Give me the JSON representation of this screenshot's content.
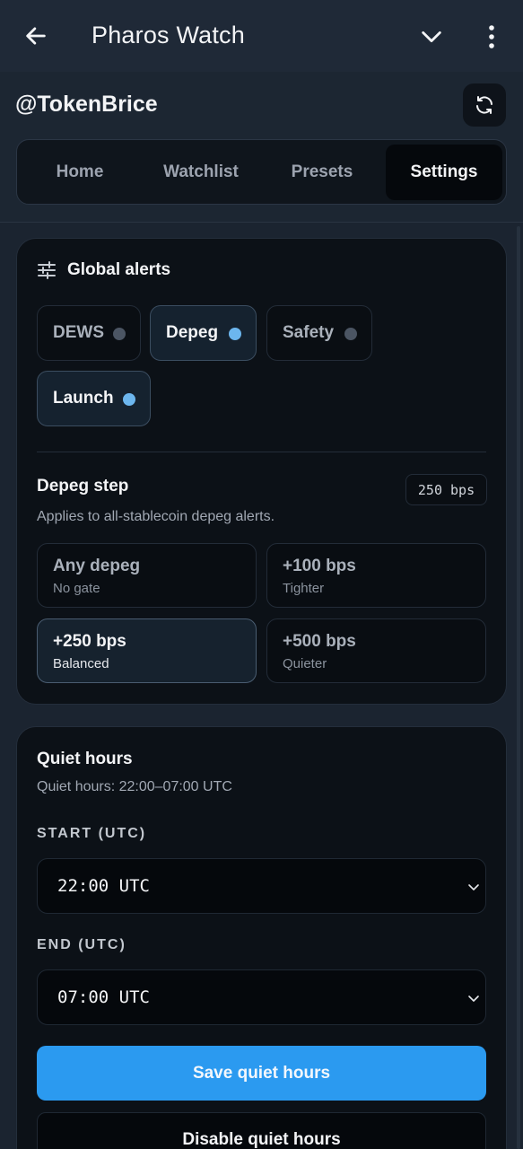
{
  "app": {
    "title": "Pharos Watch"
  },
  "header": {
    "handle": "@TokenBrice"
  },
  "tabs": [
    {
      "label": "Home"
    },
    {
      "label": "Watchlist"
    },
    {
      "label": "Presets"
    },
    {
      "label": "Settings",
      "active": true
    }
  ],
  "global_alerts": {
    "title": "Global alerts",
    "chips": [
      {
        "label": "DEWS",
        "enabled": false
      },
      {
        "label": "Depeg",
        "enabled": true
      },
      {
        "label": "Safety",
        "enabled": false
      },
      {
        "label": "Launch",
        "enabled": true
      }
    ],
    "depeg_step": {
      "title": "Depeg step",
      "value_badge": "250 bps",
      "description": "Applies to all-stablecoin depeg alerts.",
      "options": [
        {
          "title": "Any depeg",
          "sub": "No gate",
          "selected": false
        },
        {
          "title": "+100 bps",
          "sub": "Tighter",
          "selected": false
        },
        {
          "title": "+250 bps",
          "sub": "Balanced",
          "selected": true
        },
        {
          "title": "+500 bps",
          "sub": "Quieter",
          "selected": false
        }
      ]
    }
  },
  "quiet_hours": {
    "title": "Quiet hours",
    "summary": "Quiet hours: 22:00–07:00 UTC",
    "start_label": "START (UTC)",
    "start_value": "22:00 UTC",
    "end_label": "END (UTC)",
    "end_value": "07:00 UTC",
    "save_label": "Save quiet hours",
    "disable_label": "Disable quiet hours"
  },
  "colors": {
    "accent": "#2b9af0",
    "enabled_dot": "#6cb6ee",
    "disabled_dot": "#4b5563"
  },
  "icons": {
    "back": "arrow-left-icon",
    "dropdown": "chevron-down-icon",
    "more": "more-vertical-icon",
    "refresh": "refresh-icon",
    "sliders": "sliders-icon"
  }
}
